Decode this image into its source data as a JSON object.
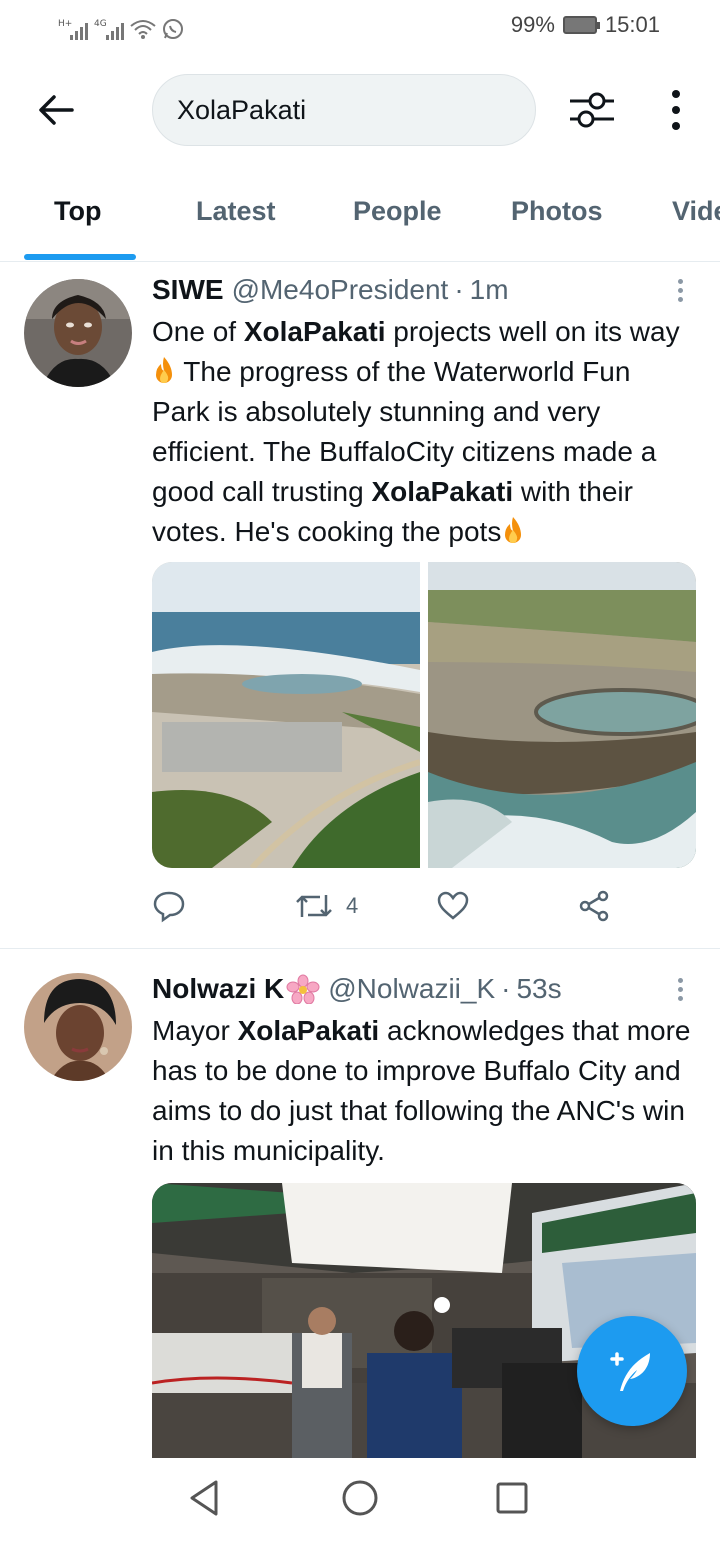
{
  "status_bar": {
    "signal1_label": "H+",
    "signal2_label": "4G",
    "battery_percent": "99%",
    "time": "15:01"
  },
  "search": {
    "query": "XolaPakati"
  },
  "tabs": [
    {
      "label": "Top",
      "active": true
    },
    {
      "label": "Latest",
      "active": false
    },
    {
      "label": "People",
      "active": false
    },
    {
      "label": "Photos",
      "active": false
    },
    {
      "label": "Videos",
      "active": false
    }
  ],
  "tweets": [
    {
      "name": "SIWE",
      "handle": "@Me4oPresident",
      "separator": "·",
      "time": "1m",
      "text": {
        "p1": "One of ",
        "p2": "XolaPakati",
        "p3": " projects well on its way",
        "p4": " The progress of the Waterworld Fun Park is absolutely stunning and very efficient. The BuffaloCity citizens made a good call trusting ",
        "p5": "XolaPakati",
        "p6": " with their votes. He's cooking the pots"
      },
      "retweet_count": "4"
    },
    {
      "name": "Nolwazi K",
      "handle": "@Nolwazii_K",
      "separator": "·",
      "time": "53s",
      "text": {
        "p1": "Mayor ",
        "p2": "XolaPakati",
        "p3": " acknowledges that more has to be done to improve Buffalo City and aims to do just that following the ANC's win in this municipality."
      }
    }
  ],
  "colors": {
    "accent": "#1d9bf0",
    "text_primary": "#0f1419",
    "text_secondary": "#536471",
    "search_bg": "#eff3f4"
  }
}
